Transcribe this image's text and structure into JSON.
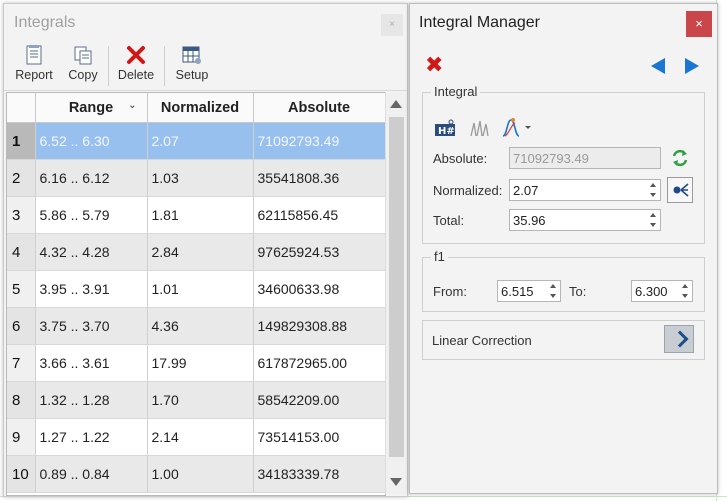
{
  "integrals_panel": {
    "title": "Integrals",
    "close_label": "×",
    "toolbar": {
      "report_label": "Report",
      "copy_label": "Copy",
      "delete_label": "Delete",
      "setup_label": "Setup"
    },
    "columns": [
      "Range",
      "Normalized",
      "Absolute"
    ],
    "rows": [
      {
        "n": "1",
        "range": "6.52 .. 6.30",
        "normalized": "2.07",
        "absolute": "71092793.49"
      },
      {
        "n": "2",
        "range": "6.16 .. 6.12",
        "normalized": "1.03",
        "absolute": "35541808.36"
      },
      {
        "n": "3",
        "range": "5.86 .. 5.79",
        "normalized": "1.81",
        "absolute": "62115856.45"
      },
      {
        "n": "4",
        "range": "4.32 .. 4.28",
        "normalized": "2.84",
        "absolute": "97625924.53"
      },
      {
        "n": "5",
        "range": "3.95 .. 3.91",
        "normalized": "1.01",
        "absolute": "34600633.98"
      },
      {
        "n": "6",
        "range": "3.75 .. 3.70",
        "normalized": "4.36",
        "absolute": "149829308.88"
      },
      {
        "n": "7",
        "range": "3.66 .. 3.61",
        "normalized": "17.99",
        "absolute": "617872965.00"
      },
      {
        "n": "8",
        "range": "1.32 .. 1.28",
        "normalized": "1.70",
        "absolute": "58542209.00"
      },
      {
        "n": "9",
        "range": "1.27 .. 1.22",
        "normalized": "2.14",
        "absolute": "73514153.00"
      },
      {
        "n": "10",
        "range": "0.89 .. 0.84",
        "normalized": "1.00",
        "absolute": "34183339.78"
      }
    ],
    "selected_row": 1
  },
  "manager_panel": {
    "title": "Integral Manager",
    "close_label": "×",
    "integral_group": {
      "title": "Integral",
      "absolute_label": "Absolute:",
      "absolute_value": "71092793.49",
      "normalized_label": "Normalized:",
      "normalized_value": "2.07",
      "total_label": "Total:",
      "total_value": "35.96"
    },
    "f1_group": {
      "title": "f1",
      "from_label": "From:",
      "from_value": "6.515",
      "to_label": "To:",
      "to_value": "6.300"
    },
    "linear_correction_label": "Linear Correction"
  },
  "colors": {
    "selection": "#98c0ef",
    "delete_red": "#d01818",
    "nav_blue": "#1976d2",
    "close_red": "#c9474a",
    "refresh_green": "#2ea043"
  }
}
